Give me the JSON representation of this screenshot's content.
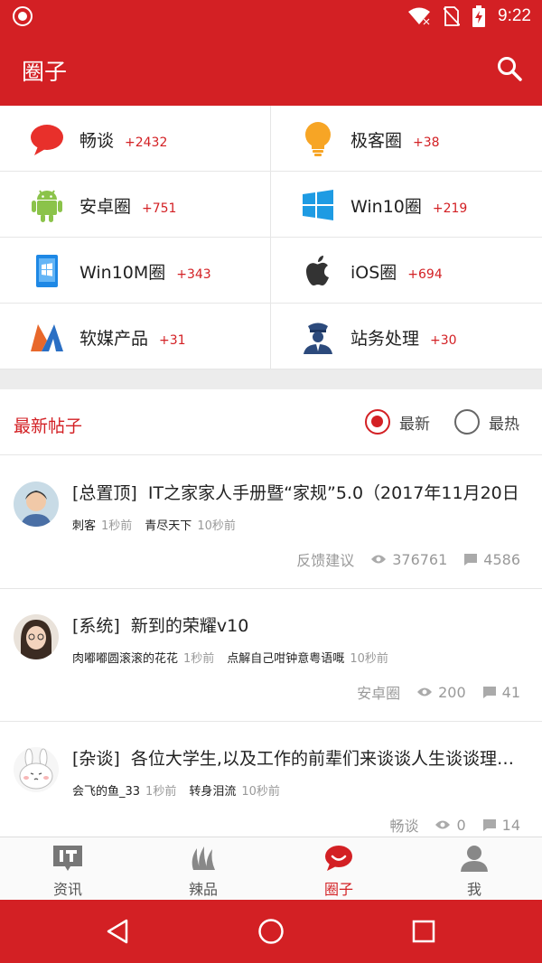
{
  "status": {
    "time": "9:22"
  },
  "appbar": {
    "title": "圈子"
  },
  "circles": [
    {
      "name": "畅谈",
      "count": "+2432",
      "icon": "chat-bubble-icon"
    },
    {
      "name": "极客圈",
      "count": "+38",
      "icon": "lightbulb-icon"
    },
    {
      "name": "安卓圈",
      "count": "+751",
      "icon": "android-icon"
    },
    {
      "name": "Win10圈",
      "count": "+219",
      "icon": "windows-icon"
    },
    {
      "name": "Win10M圈",
      "count": "+343",
      "icon": "windows-mobile-icon"
    },
    {
      "name": "iOS圈",
      "count": "+694",
      "icon": "apple-icon"
    },
    {
      "name": "软媒产品",
      "count": "+31",
      "icon": "ruanmei-logo-icon"
    },
    {
      "name": "站务处理",
      "count": "+30",
      "icon": "officer-icon"
    }
  ],
  "section": {
    "title": "最新帖子",
    "latest": "最新",
    "hottest": "最热"
  },
  "posts": [
    {
      "tag": "[总置顶]",
      "title": "IT之家家人手册暨“家规”5.0（2017年11月20日",
      "author": "刺客",
      "author_time": "1秒前",
      "replier": "青尽天下",
      "reply_time": "10秒前",
      "board": "反馈建议",
      "views": "376761",
      "comments": "4586"
    },
    {
      "tag": "[系统]",
      "title": "新到的荣耀v10",
      "author": "肉嘟嘟圆滚滚的花花",
      "author_time": "1秒前",
      "replier": "点解自己咁钟意粤语嘅",
      "reply_time": "10秒前",
      "board": "安卓圈",
      "views": "200",
      "comments": "41"
    },
    {
      "tag": "[杂谈]",
      "title": "各位大学生,以及工作的前辈们来谈谈人生谈谈理想吧",
      "author": "会飞的鱼_33",
      "author_time": "1秒前",
      "replier": "转身泪流",
      "reply_time": "10秒前",
      "board": "畅谈",
      "views": "0",
      "comments": "14"
    }
  ],
  "tabs": [
    {
      "label": "资讯",
      "icon": "it-news-icon"
    },
    {
      "label": "辣品",
      "icon": "chili-icon"
    },
    {
      "label": "圈子",
      "icon": "circle-chat-icon"
    },
    {
      "label": "我",
      "icon": "person-icon"
    }
  ],
  "colors": {
    "brand": "#d32024"
  }
}
